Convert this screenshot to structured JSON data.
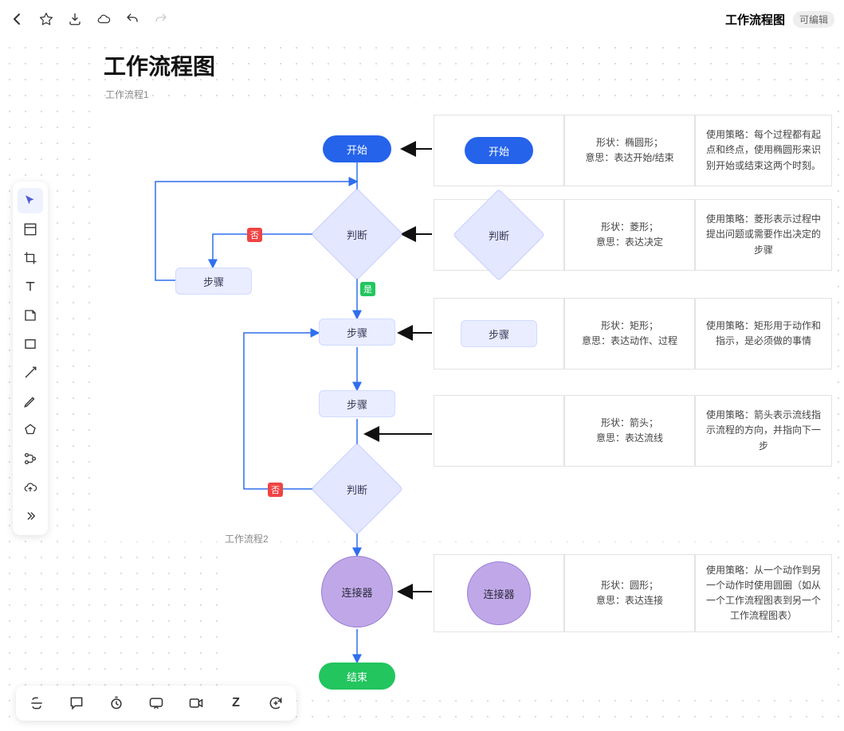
{
  "header": {
    "doc_title": "工作流程图",
    "badge": "可编辑"
  },
  "page_title": "工作流程图",
  "sections": {
    "s1": "工作流程1",
    "s2": "工作流程2"
  },
  "nodes": {
    "start": "开始",
    "judge": "判断",
    "step": "步骤",
    "connector": "连接器",
    "end": "结束"
  },
  "labels": {
    "no": "否",
    "yes": "是"
  },
  "legend": {
    "start": {
      "sample": "开始",
      "shape_label": "形状：椭圆形；",
      "meaning_label": "意思：表达开始/结束",
      "strategy": "使用策略：每个过程都有起点和终点，使用椭圆形来识别开始或结束这两个时刻。"
    },
    "judge": {
      "sample": "判断",
      "shape_label": "形状：菱形；",
      "meaning_label": "意思：表达决定",
      "strategy": "使用策略：菱形表示过程中提出问题或需要作出决定的步骤"
    },
    "step": {
      "sample": "步骤",
      "shape_label": "形状：矩形；",
      "meaning_label": "意思：表达动作、过程",
      "strategy": "使用策略：矩形用于动作和指示，是必须做的事情"
    },
    "arrow": {
      "shape_label": "形状：箭头；",
      "meaning_label": "意思：表达流线",
      "strategy": "使用策略：箭头表示流线指示流程的方向，并指向下一步"
    },
    "connector": {
      "sample": "连接器",
      "shape_label": "形状：圆形；",
      "meaning_label": "意思：表达连接",
      "strategy": "使用策略：从一个动作到另一个动作时使用圆圈（如从一个工作流程图表到另一个工作流程图表）"
    }
  }
}
